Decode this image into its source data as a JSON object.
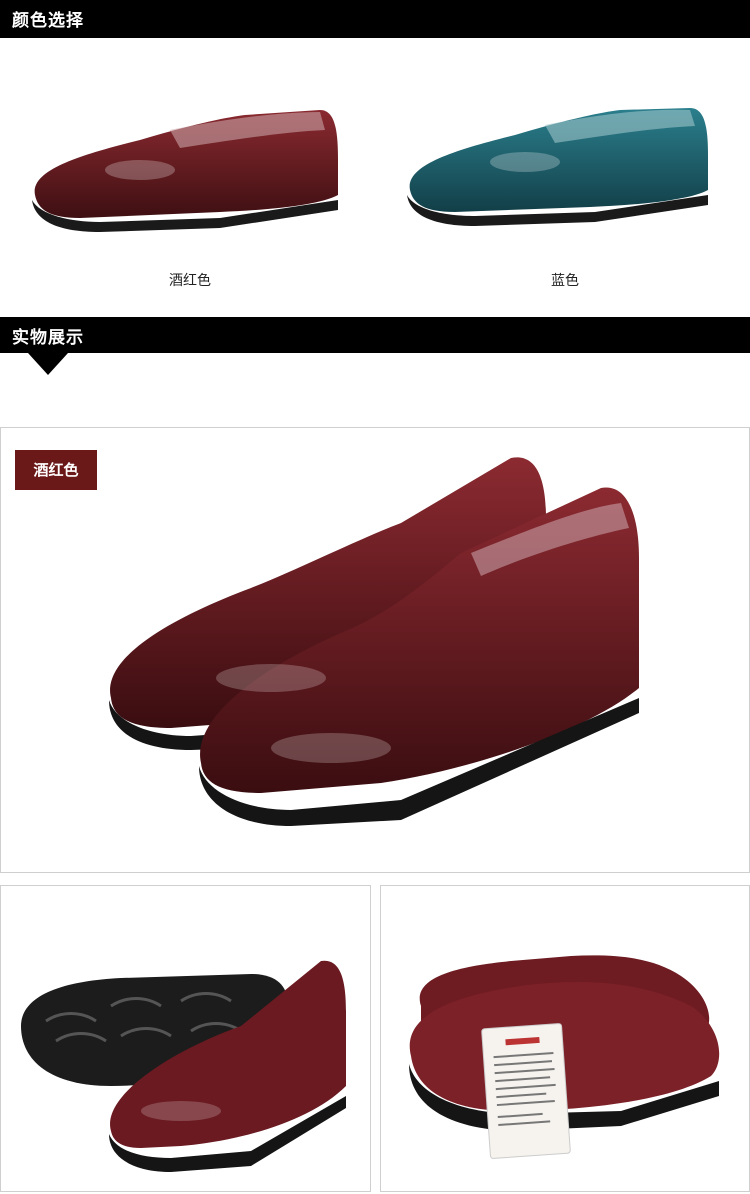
{
  "sections": {
    "color_select_title": "颜色选择",
    "showcase_title": "实物展示"
  },
  "color_options": [
    {
      "label": "酒红色",
      "color": "#5a1a1e"
    },
    {
      "label": "蓝色",
      "color": "#1c5f6b"
    }
  ],
  "showcase": {
    "main_tag": "酒红色",
    "tag_color": "#6b1818"
  },
  "icons": [
    "shoe-burgundy-icon",
    "shoe-blue-icon",
    "shoe-pair-icon",
    "shoe-sole-icon",
    "certificate-card-icon"
  ]
}
